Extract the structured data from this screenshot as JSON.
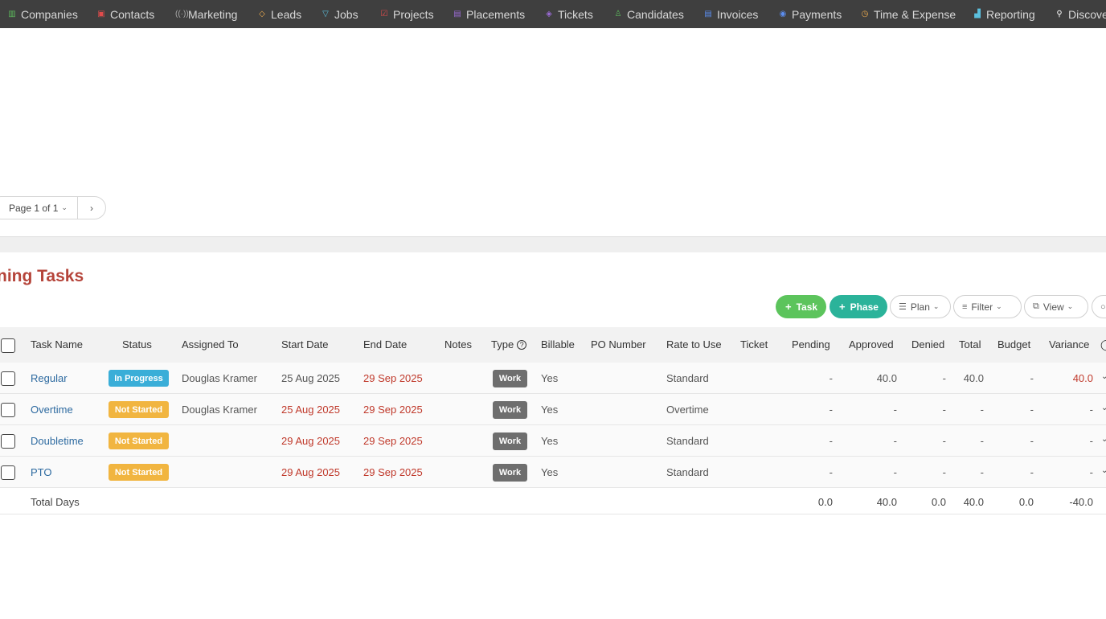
{
  "nav": {
    "items": [
      {
        "label": "Companies",
        "icon": "building-icon",
        "color": "#5cb85c"
      },
      {
        "label": "Contacts",
        "icon": "contact-card-icon",
        "color": "#e04b4b"
      },
      {
        "label": "Marketing",
        "icon": "broadcast-icon",
        "color": "#aaaaaa"
      },
      {
        "label": "Leads",
        "icon": "diamond-icon",
        "color": "#f0ad4e"
      },
      {
        "label": "Jobs",
        "icon": "trophy-icon",
        "color": "#5bc0de"
      },
      {
        "label": "Projects",
        "icon": "checklist-icon",
        "color": "#e04b4b"
      },
      {
        "label": "Placements",
        "icon": "briefcase-icon",
        "color": "#9b6bd6"
      },
      {
        "label": "Tickets",
        "icon": "tag-icon",
        "color": "#9b6bd6"
      },
      {
        "label": "Candidates",
        "icon": "person-icon",
        "color": "#5cb85c"
      },
      {
        "label": "Invoices",
        "icon": "document-icon",
        "color": "#5b8def"
      },
      {
        "label": "Payments",
        "icon": "coin-icon",
        "color": "#5b8def"
      },
      {
        "label": "Time & Expense",
        "icon": "clock-icon",
        "color": "#f0ad4e"
      },
      {
        "label": "Reporting",
        "icon": "bar-chart-icon",
        "color": "#5bc0de"
      },
      {
        "label": "Discove",
        "icon": "search-icon",
        "color": "#ffffff"
      }
    ]
  },
  "pager": {
    "label": "Page 1 of 1",
    "next": "›"
  },
  "section": {
    "title": "ning Tasks"
  },
  "actions": {
    "task": "Task",
    "phase": "Phase",
    "plan": "Plan",
    "filter": "Filter",
    "view": "View"
  },
  "table": {
    "headers": {
      "task_name": "Task Name",
      "status": "Status",
      "assigned_to": "Assigned To",
      "start_date": "Start Date",
      "end_date": "End Date",
      "notes": "Notes",
      "type": "Type",
      "billable": "Billable",
      "po_number": "PO Number",
      "rate": "Rate to Use",
      "ticket": "Ticket",
      "pending": "Pending",
      "approved": "Approved",
      "denied": "Denied",
      "total": "Total",
      "budget": "Budget",
      "variance": "Variance"
    },
    "rows": [
      {
        "name": "Regular",
        "status": "In Progress",
        "assigned": "Douglas Kramer",
        "start": "25 Aug 2025",
        "start_overdue": false,
        "end": "29 Sep 2025",
        "type": "Work",
        "billable": "Yes",
        "rate": "Standard",
        "pending": "-",
        "approved": "40.0",
        "denied": "-",
        "total": "40.0",
        "budget": "-",
        "variance": "40.0"
      },
      {
        "name": "Overtime",
        "status": "Not Started",
        "assigned": "Douglas Kramer",
        "start": "25 Aug 2025",
        "start_overdue": true,
        "end": "29 Sep 2025",
        "type": "Work",
        "billable": "Yes",
        "rate": "Overtime",
        "pending": "-",
        "approved": "-",
        "denied": "-",
        "total": "-",
        "budget": "-",
        "variance": "-"
      },
      {
        "name": "Doubletime",
        "status": "Not Started",
        "assigned": "",
        "start": "29 Aug 2025",
        "start_overdue": true,
        "end": "29 Sep 2025",
        "type": "Work",
        "billable": "Yes",
        "rate": "Standard",
        "pending": "-",
        "approved": "-",
        "denied": "-",
        "total": "-",
        "budget": "-",
        "variance": "-"
      },
      {
        "name": "PTO",
        "status": "Not Started",
        "assigned": "",
        "start": "29 Aug 2025",
        "start_overdue": true,
        "end": "29 Sep 2025",
        "type": "Work",
        "billable": "Yes",
        "rate": "Standard",
        "pending": "-",
        "approved": "-",
        "denied": "-",
        "total": "-",
        "budget": "-",
        "variance": "-"
      }
    ],
    "totals": {
      "label": "Total Days",
      "pending": "0.0",
      "approved": "40.0",
      "denied": "0.0",
      "total": "40.0",
      "budget": "0.0",
      "variance": "-40.0"
    }
  }
}
